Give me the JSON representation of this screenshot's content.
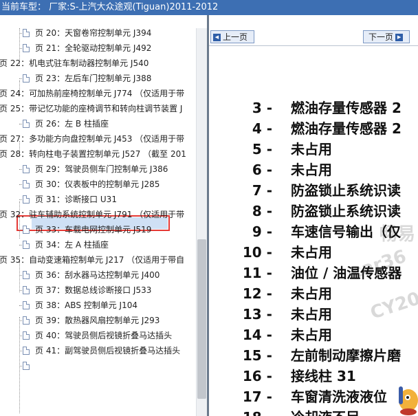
{
  "window": {
    "title": "当前车型：  厂家:S-上汽大众途观(Tiguan)2011-2012"
  },
  "tree": {
    "items": [
      {
        "text": "页 20：天窗卷帘控制单元 J394",
        "type": "page"
      },
      {
        "text": "页 21：全轮驱动控制单元 J492",
        "type": "page"
      },
      {
        "text": "页 22：机电式驻车制动器控制单元 J540",
        "type": "group"
      },
      {
        "text": "页 23：左后车门控制单元 J388",
        "type": "page"
      },
      {
        "text": "页 24：可加热前座椅控制单元 J774 （仅适用于带",
        "type": "group"
      },
      {
        "text": "页 25：带记忆功能的座椅调节和转向柱调节装置 J",
        "type": "group"
      },
      {
        "text": "页 26：左 B 柱插座",
        "type": "page"
      },
      {
        "text": "页 27：多功能方向盘控制单元 J453 （仅适用于带",
        "type": "group"
      },
      {
        "text": "页 28：转向柱电子装置控制单元 J527 （截至 201",
        "type": "group"
      },
      {
        "text": "页 29：驾驶员侧车门控制单元 J386",
        "type": "page"
      },
      {
        "text": "页 30：仪表板中的控制单元 J285",
        "type": "page",
        "selected": true
      },
      {
        "text": "页 31：诊断接口 U31",
        "type": "page"
      },
      {
        "text": "页 32：驻车辅助系统控制单元 J791 （仅适用于带",
        "type": "group"
      },
      {
        "text": "页 33：车载电网控制单元 J519",
        "type": "page"
      },
      {
        "text": "页 34：左 A 柱插座",
        "type": "page"
      },
      {
        "text": "页 35：自动变速箱控制单元 J217 （仅适用于带自",
        "type": "group"
      },
      {
        "text": "页 36：刮水器马达控制单元 J400",
        "type": "page"
      },
      {
        "text": "页 37：数据总线诊断接口 J533",
        "type": "page"
      },
      {
        "text": "页 38：ABS 控制单元 J104",
        "type": "page"
      },
      {
        "text": "页 39：散热器风扇控制单元 J293",
        "type": "page"
      },
      {
        "text": "页 40：驾驶员侧后视镜折叠马达插头",
        "type": "page"
      },
      {
        "text": "页 41：副驾驶员侧后视镜折叠马达插头",
        "type": "page"
      },
      {
        "text": "",
        "type": "page"
      }
    ]
  },
  "nav": {
    "prev_label": "上一页",
    "next_label": "下一页"
  },
  "pins": [
    {
      "num": "3 -",
      "name": "燃油存量传感器 2"
    },
    {
      "num": "4 -",
      "name": "燃油存量传感器 2"
    },
    {
      "num": "5 -",
      "name": "未占用"
    },
    {
      "num": "6 -",
      "name": "未占用"
    },
    {
      "num": "7 -",
      "name": "防盗锁止系统识读"
    },
    {
      "num": "8 -",
      "name": "防盗锁止系统识读"
    },
    {
      "num": "9 -",
      "name": "车速信号输出（仅"
    },
    {
      "num": "10 -",
      "name": "未占用"
    },
    {
      "num": "11 -",
      "name": "油位 / 油温传感器"
    },
    {
      "num": "12 -",
      "name": "未占用"
    },
    {
      "num": "13 -",
      "name": "未占用"
    },
    {
      "num": "14 -",
      "name": "未占用"
    },
    {
      "num": "15 -",
      "name": "左前制动摩擦片磨"
    },
    {
      "num": "16 -",
      "name": "接线柱 31"
    },
    {
      "num": "17 -",
      "name": "车窗清洗液液位"
    },
    {
      "num": "18 -",
      "name": "冷却液不足"
    }
  ],
  "watermark": {
    "line1": "畅易",
    "line2": "car36",
    "line3": "CY20"
  },
  "colors": {
    "titlebar": "#3d6fb3",
    "selection_highlight": "#cfe0f5",
    "selection_border": "#e53935"
  }
}
